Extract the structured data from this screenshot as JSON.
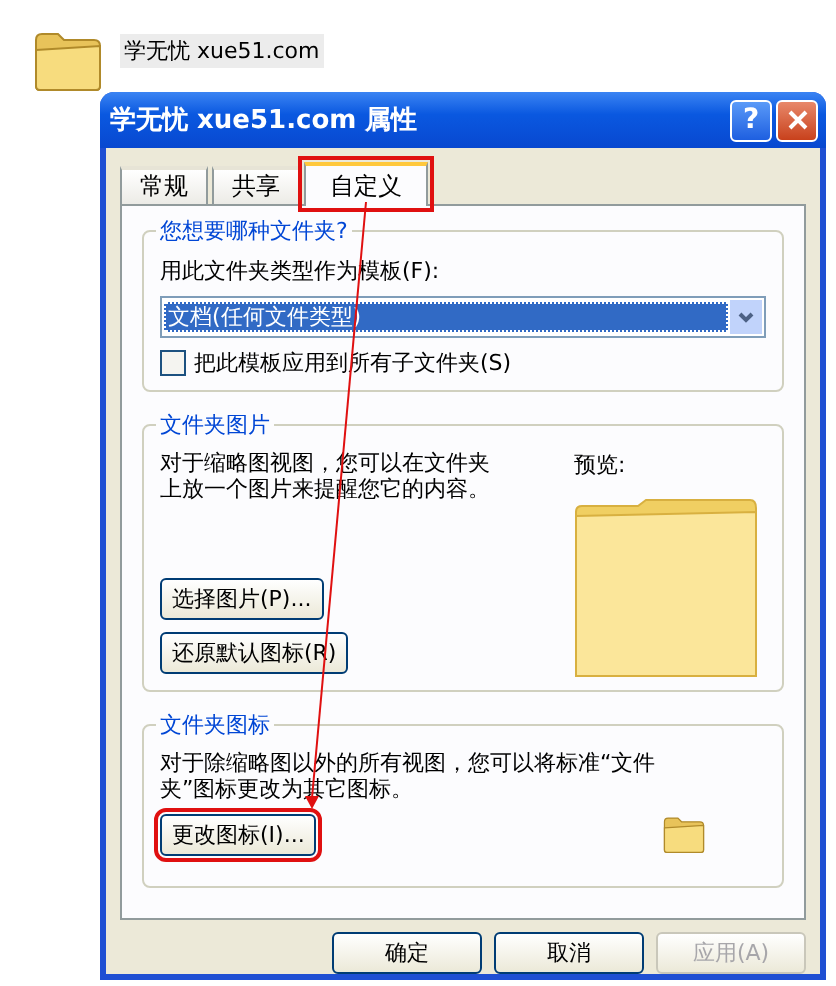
{
  "desktop_icon": {
    "label": "学无忧 xue51.com"
  },
  "window": {
    "title": "学无忧 xue51.com 属性",
    "help_button": "?"
  },
  "tabs": [
    {
      "label": "常规",
      "selected": false,
      "highlighted": false
    },
    {
      "label": "共享",
      "selected": false,
      "highlighted": false
    },
    {
      "label": "自定义",
      "selected": true,
      "highlighted": true
    }
  ],
  "folder_type": {
    "title": "您想要哪种文件夹?",
    "template_label": "用此文件夹类型作为模板(F):",
    "template_value": "文档(任何文件类型)",
    "apply_checkbox": {
      "label": "把此模板应用到所有子文件夹(S)",
      "checked": false
    }
  },
  "folder_picture": {
    "title": "文件夹图片",
    "description": "对于缩略图视图，您可以在文件夹上放一个图片来提醒您它的内容。",
    "preview_label": "预览:",
    "buttons": [
      {
        "label": "选择图片(P)...",
        "highlighted": false
      },
      {
        "label": "还原默认图标(R)",
        "highlighted": false
      }
    ]
  },
  "folder_icon": {
    "title": "文件夹图标",
    "description": "对于除缩略图以外的所有视图，您可以将标准“文件夹”图标更改为其它图标。",
    "buttons": [
      {
        "label": "更改图标(I)...",
        "highlighted": true
      }
    ]
  },
  "dialog_buttons": [
    {
      "label": "确定",
      "disabled": false
    },
    {
      "label": "取消",
      "disabled": false
    },
    {
      "label": "应用(A)",
      "disabled": true
    }
  ]
}
